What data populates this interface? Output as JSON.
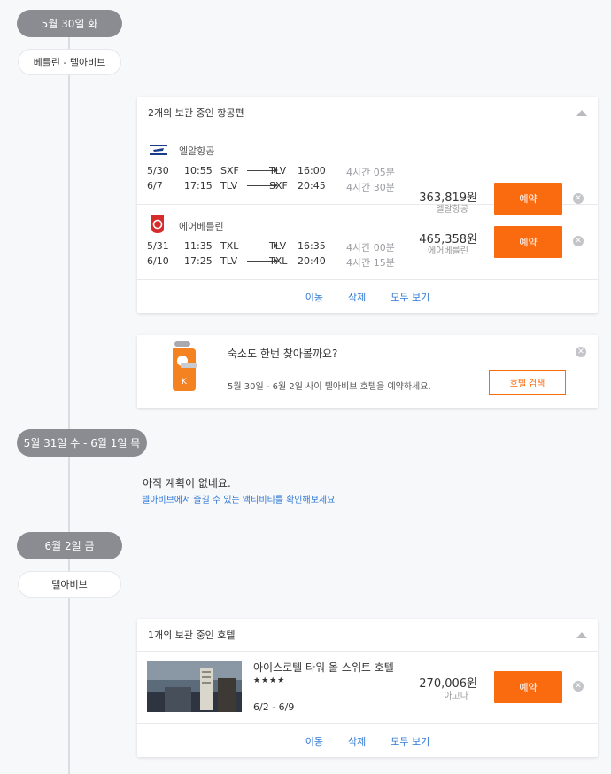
{
  "day1": {
    "date": "5월 30일 화",
    "city": "베를린 - 텔아비브"
  },
  "saved_flights": {
    "title": "2개의 보관 중인 항공편",
    "flights": [
      {
        "airline": "엘알항공",
        "price": "363,819원",
        "provider": "엘알항공",
        "book": "예약",
        "legs": [
          {
            "date": "5/30",
            "dep_time": "10:55",
            "from": "SXF",
            "to": "TLV",
            "arr_time": "16:00",
            "duration": "4시간 05분"
          },
          {
            "date": "6/7",
            "dep_time": "17:15",
            "from": "TLV",
            "to": "SXF",
            "arr_time": "20:45",
            "duration": "4시간 30분"
          }
        ]
      },
      {
        "airline": "에어베를린",
        "price": "465,358원",
        "provider": "에어베를린",
        "book": "예약",
        "legs": [
          {
            "date": "5/31",
            "dep_time": "11:35",
            "from": "TXL",
            "to": "TLV",
            "arr_time": "16:35",
            "duration": "4시간 00분"
          },
          {
            "date": "6/10",
            "dep_time": "17:25",
            "from": "TLV",
            "to": "TXL",
            "arr_time": "20:40",
            "duration": "4시간 15분"
          }
        ]
      }
    ],
    "actions": {
      "move": "이동",
      "delete": "삭제",
      "view_all": "모두 보기"
    }
  },
  "hotel_promo": {
    "title": "숙소도 한번 찾아볼까요?",
    "subtitle": "5월 30일 - 6월 2일 사이 텔아비브 호텔을 예약하세요.",
    "button": "호텔 검색",
    "icon_letter": "K"
  },
  "day2": {
    "date": "5월 31일 수 - 6월 1일 목",
    "no_plan": "아직 계획이 없네요.",
    "activity_link": "텔아비브에서 즐길 수 있는 액티비티를 확인해보세요"
  },
  "day3": {
    "date": "6월 2일 금",
    "city": "텔아비브"
  },
  "saved_hotels": {
    "title": "1개의 보관 중인 호텔",
    "hotel": {
      "name": "아이스로텔 타워 올 스위트 호텔",
      "stars": "★★★★",
      "dates": "6/2 - 6/9",
      "price": "270,006원",
      "provider": "아고다",
      "book": "예약"
    },
    "actions": {
      "move": "이동",
      "delete": "삭제",
      "view_all": "모두 보기"
    }
  },
  "colors": {
    "accent": "#fa6a0f",
    "link": "#2f78d6",
    "pill": "#8a8c91"
  }
}
